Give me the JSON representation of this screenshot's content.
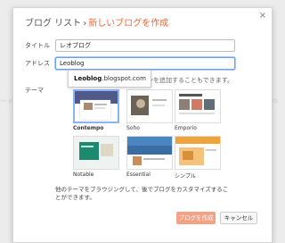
{
  "dialog": {
    "crumb": "ブログ リスト",
    "separator": "›",
    "title": "新しいブログを作成",
    "close_glyph": "×"
  },
  "form": {
    "title_label": "タイトル",
    "title_value": "レオブログ",
    "address_label": "アドレス",
    "address_value": "Leoblog",
    "address_hint": "インを追加することもできます。",
    "theme_label": "テーマ"
  },
  "suggestion": {
    "bold": "Leoblog",
    "rest": ".blogspot.com"
  },
  "themes": [
    {
      "name": "Contempo",
      "selected": true
    },
    {
      "name": "Soho",
      "selected": false
    },
    {
      "name": "Emporio",
      "selected": false
    },
    {
      "name": "Notable",
      "selected": false
    },
    {
      "name": "Essential",
      "selected": false
    },
    {
      "name": "シンプル",
      "selected": false
    }
  ],
  "footer_text": "他のテーマをブラウジングして、後でブログをカスタマイズすることができます。",
  "buttons": {
    "create": "ブログを作成",
    "cancel": "キャンセル"
  },
  "colors": {
    "accent": "#f06735",
    "create_button": "#f5a183",
    "focus_border": "#6ca0ff"
  }
}
